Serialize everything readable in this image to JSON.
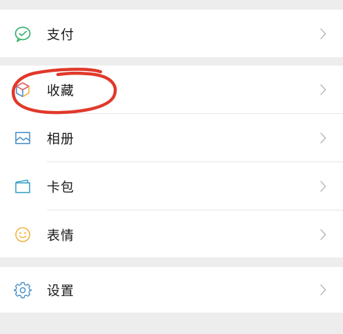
{
  "menu": {
    "payment": {
      "label": "支付",
      "icon": "wechat-pay-icon",
      "color": "#3cb371"
    },
    "favorites": {
      "label": "收藏",
      "icon": "cube-icon",
      "color": "#e8a93a"
    },
    "album": {
      "label": "相册",
      "icon": "picture-icon",
      "color": "#4a90c8"
    },
    "cards": {
      "label": "卡包",
      "icon": "wallet-icon",
      "color": "#3aa0c8"
    },
    "stickers": {
      "label": "表情",
      "icon": "smiley-icon",
      "color": "#f0b23c"
    },
    "settings": {
      "label": "设置",
      "icon": "gear-icon",
      "color": "#4a90c8"
    }
  },
  "colors": {
    "background": "#ededed",
    "surface": "#ffffff",
    "chevron": "#b8b8b8",
    "annotation": "#e0392b"
  }
}
